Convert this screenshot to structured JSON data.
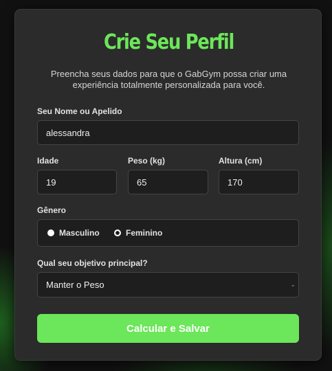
{
  "form": {
    "title": "Crie Seu Perfil",
    "subtitle": "Preencha seus dados para que o GabGym possa criar uma experiência totalmente personalizada para você.",
    "name": {
      "label": "Seu Nome ou Apelido",
      "value": "alessandra"
    },
    "age": {
      "label": "Idade",
      "value": "19"
    },
    "weight": {
      "label": "Peso (kg)",
      "value": "65"
    },
    "height": {
      "label": "Altura (cm)",
      "value": "170"
    },
    "gender": {
      "label": "Gênero",
      "options": [
        "Masculino",
        "Feminino"
      ],
      "selected": "Feminino"
    },
    "goal": {
      "label": "Qual seu objetivo principal?",
      "value": "Manter o Peso"
    },
    "submit_label": "Calcular e Salvar"
  },
  "colors": {
    "accent": "#6ce65a",
    "card": "#2b2b2b",
    "field": "#1e1e1e",
    "background": "#111111"
  },
  "icons": {
    "goal_select": "chevron-down-icon"
  }
}
